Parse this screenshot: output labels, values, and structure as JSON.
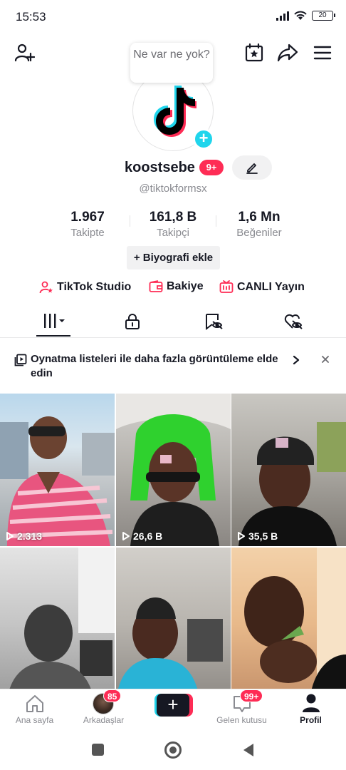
{
  "status_bar": {
    "time": "15:53",
    "battery": "20"
  },
  "tooltip": {
    "text": "Ne var ne yok?"
  },
  "profile": {
    "username": "koostsebe",
    "badge": "9+",
    "handle": "@tiktokformsx",
    "stats": [
      {
        "num": "1.967",
        "label": "Takipte"
      },
      {
        "num": "161,8 B",
        "label": "Takipçi"
      },
      {
        "num": "1,6 Mn",
        "label": "Beğeniler"
      }
    ],
    "bio_button": "+ Biyografi ekle"
  },
  "links": {
    "studio": "TikTok Studio",
    "balance": "Bakiye",
    "live": "CANLI Yayın"
  },
  "banner": {
    "text": "Oynatma listeleri ile daha fazla görüntüleme elde edin"
  },
  "videos": [
    {
      "views": "2.313"
    },
    {
      "views": "26,6 B"
    },
    {
      "views": "35,5 B"
    },
    {
      "views": ""
    },
    {
      "views": ""
    },
    {
      "views": ""
    }
  ],
  "bottom_nav": {
    "home": "Ana sayfa",
    "friends": "Arkadaşlar",
    "friends_count": "85",
    "inbox": "Gelen kutusu",
    "inbox_count": "99+",
    "profile": "Profil"
  },
  "colors": {
    "accent": "#fe2c55",
    "cyan": "#20d5ec",
    "text": "#161823",
    "muted": "#8a8b91"
  }
}
